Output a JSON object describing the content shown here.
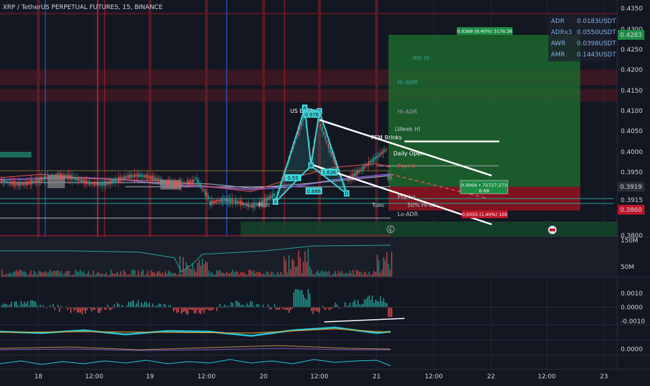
{
  "header": {
    "symbol_title": "XRP / TetherUS PERPETUAL FUTURES, 15, BINANCE"
  },
  "stats": [
    {
      "label": "ADR",
      "value": "0.0183USDT"
    },
    {
      "label": "ADRx3",
      "value": "0.0550USDT"
    },
    {
      "label": "AWR",
      "value": "0.0398USDT"
    },
    {
      "label": "AMR",
      "value": "0.1443USDT"
    }
  ],
  "price_axis": {
    "ticks": [
      "0.4350",
      "0.4300",
      "0.4250",
      "0.4200",
      "0.4150",
      "0.4100",
      "0.4050",
      "0.4000",
      "0.3950",
      "0.3915",
      "0.3800"
    ],
    "badges": [
      {
        "text": "0.4283",
        "color": "#1e8c45"
      },
      {
        "text": "0.3919",
        "color": "#2a2e39"
      },
      {
        "text": "0.3860",
        "color": "#c0162b"
      }
    ],
    "volume_ticks": [
      "150M",
      "50M"
    ],
    "osc_ticks": [
      "0.0010",
      "0.0000",
      "-0.0010"
    ],
    "osc2_ticks": [
      "0.0000"
    ]
  },
  "time_axis": {
    "labels": [
      "18",
      "12:00",
      "19",
      "12:00",
      "20",
      "12:00",
      "21",
      "12:00",
      "22",
      "12:00",
      "23"
    ]
  },
  "levels": [
    "RW Hi",
    "Hi AWR",
    "Hi-ADR",
    "LWeek HI",
    "PEM Brinks",
    "Daily Open",
    "Psy-Hi",
    "Psy-Lo",
    "50% Hi-Lo",
    "Lo-ADR",
    "Mon",
    "Tues",
    "US Brinks"
  ],
  "pattern": {
    "points": [
      "X",
      "A",
      "B",
      "C",
      "D"
    ],
    "ratios": [
      "0.55",
      "0.976",
      "1.636",
      "0.886"
    ]
  },
  "position": {
    "target_label": "0.0368 (9.40%) 3176.36",
    "entry_label": "0.0004 • 72727.273",
    "entry_sub": "6.69",
    "stop_label": "0.0055 (1.40%) 100"
  },
  "colors": {
    "background": "#131722",
    "bull": "#26a69a",
    "bear": "#ef5350",
    "profit_zone": "#1e6b2e",
    "loss_zone": "#8c1420",
    "harmonic": "#3ed1d8"
  },
  "chart_data": {
    "type": "line",
    "title": "XRP / TetherUS PERPETUAL FUTURES, 15, BINANCE",
    "xlabel": "",
    "ylabel": "",
    "ylim": [
      0.38,
      0.435
    ],
    "x": [
      "18",
      "19",
      "20",
      "21"
    ],
    "series": [
      {
        "name": "",
        "values": [
          0.395,
          0.3945,
          0.3925,
          0.4005
        ]
      }
    ],
    "annotations": [
      "0.4283",
      "0.3919",
      "0.3860"
    ]
  }
}
